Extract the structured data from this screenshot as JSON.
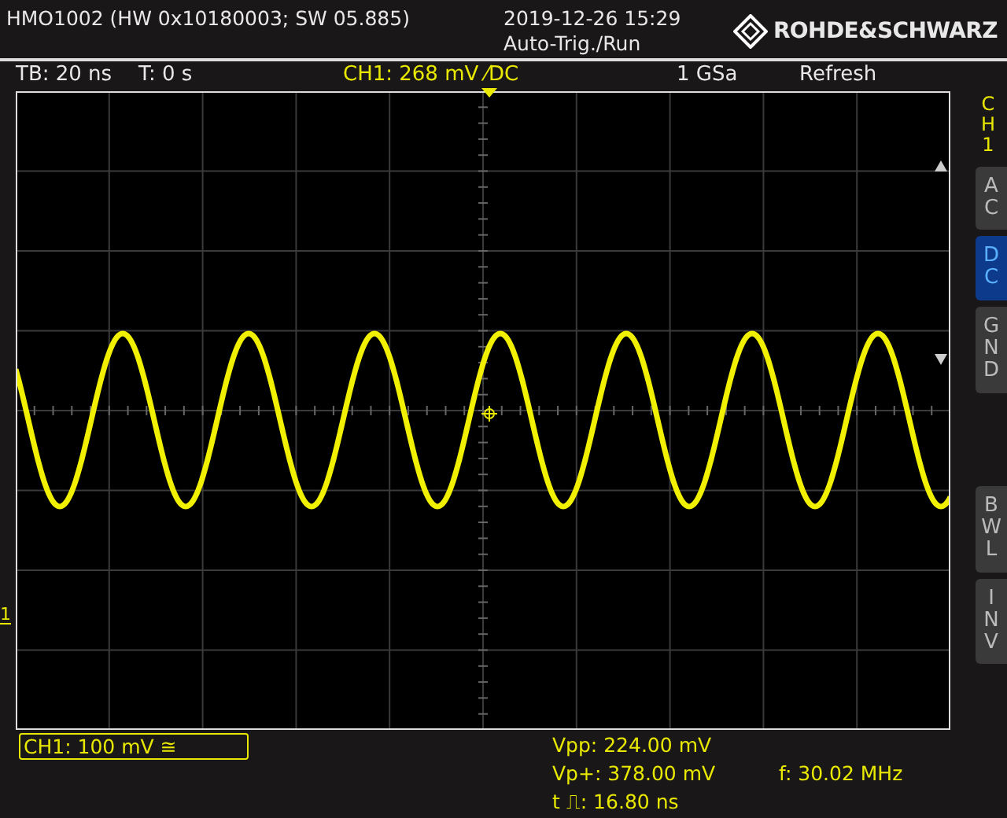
{
  "header": {
    "device": "HMO1002 (HW 0x10180003; SW 05.885)",
    "datetime": "2019-12-26 15:29",
    "trigger_mode": "Auto-Trig./Run",
    "brand": "ROHDE&SCHWARZ"
  },
  "info_bar": {
    "timebase": "TB: 20 ns",
    "trigger_time": "T: 0 s",
    "channel": "CH1: 268 mV ⁄DC",
    "sample_rate": "1 GSa",
    "acquisition": "Refresh"
  },
  "ground_marker": "1",
  "sidebar": {
    "title": "CH1",
    "buttons": [
      {
        "label": "AC",
        "selected": false
      },
      {
        "label": "DC",
        "selected": true
      },
      {
        "label": "GND",
        "selected": false
      },
      {
        "label": "BWL",
        "selected": false
      },
      {
        "label": "INV",
        "selected": false
      }
    ]
  },
  "status": {
    "channel_scale": "CH1: 100 mV ≅",
    "measurements": [
      {
        "text": "Vpp: 224.00 mV"
      },
      {
        "text": "Vp+: 378.00 mV"
      },
      {
        "text": "f: 30.02 MHz"
      },
      {
        "text": "t ⎍: 16.80 ns"
      }
    ]
  }
}
